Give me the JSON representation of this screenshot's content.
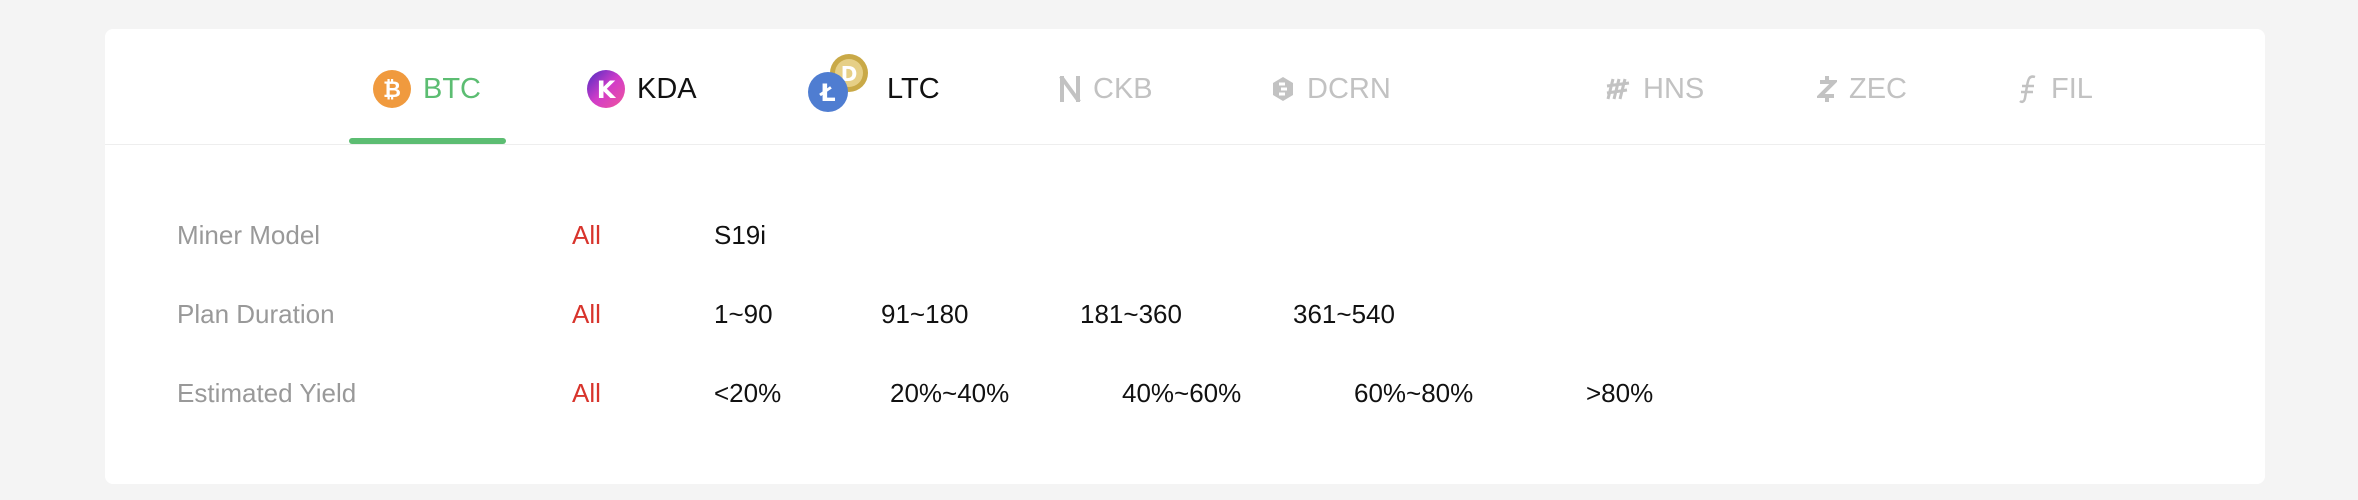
{
  "tabs": [
    {
      "label": "BTC",
      "icon": "btc-icon",
      "state": "active",
      "color": "#5cbd72"
    },
    {
      "label": "KDA",
      "icon": "kda-icon",
      "state": "enabled"
    },
    {
      "label": "LTC",
      "icon": "ltc-doge-icon",
      "state": "enabled"
    },
    {
      "label": "CKB",
      "icon": "ckb-icon",
      "state": "disabled"
    },
    {
      "label": "DCRN",
      "icon": "dcrn-icon",
      "state": "disabled"
    },
    {
      "label": "HNS",
      "icon": "hns-icon",
      "state": "disabled"
    },
    {
      "label": "ZEC",
      "icon": "zec-icon",
      "state": "disabled"
    },
    {
      "label": "FIL",
      "icon": "fil-icon",
      "state": "disabled"
    }
  ],
  "filters": {
    "miner_model": {
      "label": "Miner Model",
      "options": [
        "All",
        "S19i"
      ],
      "selected": "All"
    },
    "plan_duration": {
      "label": "Plan Duration",
      "options": [
        "All",
        "1~90",
        "91~180",
        "181~360",
        "361~540"
      ],
      "selected": "All"
    },
    "estimated_yield": {
      "label": "Estimated Yield",
      "options": [
        "All",
        "<20%",
        "20%~40%",
        "40%~60%",
        "60%~80%",
        ">80%"
      ],
      "selected": "All"
    }
  },
  "colors": {
    "accent_green": "#5cbd72",
    "selected_red": "#d8342c",
    "label_gray": "#999999",
    "disabled_gray": "#c2c2c2",
    "btc_orange": "#f7931a",
    "ltc_blue": "#345d9d"
  }
}
